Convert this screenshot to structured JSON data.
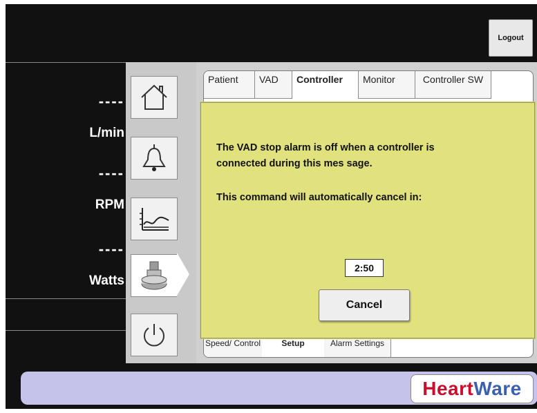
{
  "header": {
    "logout_label": "Logout"
  },
  "metrics": [
    {
      "value": "----",
      "unit": "L/min"
    },
    {
      "value": "----",
      "unit": "RPM"
    },
    {
      "value": "----",
      "unit": "Watts"
    }
  ],
  "nav": {
    "items": [
      {
        "name": "home",
        "icon": "home-icon"
      },
      {
        "name": "alarms",
        "icon": "bell-icon"
      },
      {
        "name": "trends",
        "icon": "trend-graph-icon"
      },
      {
        "name": "controller",
        "icon": "pump-icon",
        "active": true
      },
      {
        "name": "power",
        "icon": "power-icon"
      }
    ]
  },
  "tabs": {
    "top": [
      "Patient",
      "VAD",
      "Controller",
      "Monitor",
      "Controller SW"
    ],
    "top_active": "Controller",
    "bottom": [
      "Speed/ Control",
      "Setup",
      "Alarm Settings"
    ],
    "bottom_active": "Setup"
  },
  "dialog": {
    "line1": "The VAD stop alarm is off when a controller is",
    "line2": "connected during this mes sage.",
    "line3": "This command will automatically cancel in:",
    "countdown": "2:50",
    "cancel_label": "Cancel"
  },
  "footer": {
    "logo_part1": "Heart",
    "logo_part2": "Ware"
  },
  "colors": {
    "screen_bg": "#111111",
    "dialog_bg": "#e1e27e",
    "footer_bg": "#c5c3e9",
    "logo_red": "#c8102e",
    "logo_blue": "#3d5fb0"
  }
}
